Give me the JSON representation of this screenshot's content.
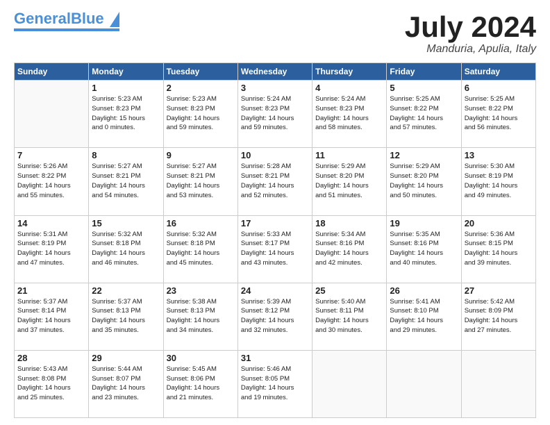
{
  "header": {
    "logo_general": "General",
    "logo_blue": "Blue",
    "month_title": "July 2024",
    "location": "Manduria, Apulia, Italy"
  },
  "days_of_week": [
    "Sunday",
    "Monday",
    "Tuesday",
    "Wednesday",
    "Thursday",
    "Friday",
    "Saturday"
  ],
  "weeks": [
    [
      {
        "day": "",
        "info": ""
      },
      {
        "day": "1",
        "info": "Sunrise: 5:23 AM\nSunset: 8:23 PM\nDaylight: 15 hours\nand 0 minutes."
      },
      {
        "day": "2",
        "info": "Sunrise: 5:23 AM\nSunset: 8:23 PM\nDaylight: 14 hours\nand 59 minutes."
      },
      {
        "day": "3",
        "info": "Sunrise: 5:24 AM\nSunset: 8:23 PM\nDaylight: 14 hours\nand 59 minutes."
      },
      {
        "day": "4",
        "info": "Sunrise: 5:24 AM\nSunset: 8:23 PM\nDaylight: 14 hours\nand 58 minutes."
      },
      {
        "day": "5",
        "info": "Sunrise: 5:25 AM\nSunset: 8:22 PM\nDaylight: 14 hours\nand 57 minutes."
      },
      {
        "day": "6",
        "info": "Sunrise: 5:25 AM\nSunset: 8:22 PM\nDaylight: 14 hours\nand 56 minutes."
      }
    ],
    [
      {
        "day": "7",
        "info": "Sunrise: 5:26 AM\nSunset: 8:22 PM\nDaylight: 14 hours\nand 55 minutes."
      },
      {
        "day": "8",
        "info": "Sunrise: 5:27 AM\nSunset: 8:21 PM\nDaylight: 14 hours\nand 54 minutes."
      },
      {
        "day": "9",
        "info": "Sunrise: 5:27 AM\nSunset: 8:21 PM\nDaylight: 14 hours\nand 53 minutes."
      },
      {
        "day": "10",
        "info": "Sunrise: 5:28 AM\nSunset: 8:21 PM\nDaylight: 14 hours\nand 52 minutes."
      },
      {
        "day": "11",
        "info": "Sunrise: 5:29 AM\nSunset: 8:20 PM\nDaylight: 14 hours\nand 51 minutes."
      },
      {
        "day": "12",
        "info": "Sunrise: 5:29 AM\nSunset: 8:20 PM\nDaylight: 14 hours\nand 50 minutes."
      },
      {
        "day": "13",
        "info": "Sunrise: 5:30 AM\nSunset: 8:19 PM\nDaylight: 14 hours\nand 49 minutes."
      }
    ],
    [
      {
        "day": "14",
        "info": "Sunrise: 5:31 AM\nSunset: 8:19 PM\nDaylight: 14 hours\nand 47 minutes."
      },
      {
        "day": "15",
        "info": "Sunrise: 5:32 AM\nSunset: 8:18 PM\nDaylight: 14 hours\nand 46 minutes."
      },
      {
        "day": "16",
        "info": "Sunrise: 5:32 AM\nSunset: 8:18 PM\nDaylight: 14 hours\nand 45 minutes."
      },
      {
        "day": "17",
        "info": "Sunrise: 5:33 AM\nSunset: 8:17 PM\nDaylight: 14 hours\nand 43 minutes."
      },
      {
        "day": "18",
        "info": "Sunrise: 5:34 AM\nSunset: 8:16 PM\nDaylight: 14 hours\nand 42 minutes."
      },
      {
        "day": "19",
        "info": "Sunrise: 5:35 AM\nSunset: 8:16 PM\nDaylight: 14 hours\nand 40 minutes."
      },
      {
        "day": "20",
        "info": "Sunrise: 5:36 AM\nSunset: 8:15 PM\nDaylight: 14 hours\nand 39 minutes."
      }
    ],
    [
      {
        "day": "21",
        "info": "Sunrise: 5:37 AM\nSunset: 8:14 PM\nDaylight: 14 hours\nand 37 minutes."
      },
      {
        "day": "22",
        "info": "Sunrise: 5:37 AM\nSunset: 8:13 PM\nDaylight: 14 hours\nand 35 minutes."
      },
      {
        "day": "23",
        "info": "Sunrise: 5:38 AM\nSunset: 8:13 PM\nDaylight: 14 hours\nand 34 minutes."
      },
      {
        "day": "24",
        "info": "Sunrise: 5:39 AM\nSunset: 8:12 PM\nDaylight: 14 hours\nand 32 minutes."
      },
      {
        "day": "25",
        "info": "Sunrise: 5:40 AM\nSunset: 8:11 PM\nDaylight: 14 hours\nand 30 minutes."
      },
      {
        "day": "26",
        "info": "Sunrise: 5:41 AM\nSunset: 8:10 PM\nDaylight: 14 hours\nand 29 minutes."
      },
      {
        "day": "27",
        "info": "Sunrise: 5:42 AM\nSunset: 8:09 PM\nDaylight: 14 hours\nand 27 minutes."
      }
    ],
    [
      {
        "day": "28",
        "info": "Sunrise: 5:43 AM\nSunset: 8:08 PM\nDaylight: 14 hours\nand 25 minutes."
      },
      {
        "day": "29",
        "info": "Sunrise: 5:44 AM\nSunset: 8:07 PM\nDaylight: 14 hours\nand 23 minutes."
      },
      {
        "day": "30",
        "info": "Sunrise: 5:45 AM\nSunset: 8:06 PM\nDaylight: 14 hours\nand 21 minutes."
      },
      {
        "day": "31",
        "info": "Sunrise: 5:46 AM\nSunset: 8:05 PM\nDaylight: 14 hours\nand 19 minutes."
      },
      {
        "day": "",
        "info": ""
      },
      {
        "day": "",
        "info": ""
      },
      {
        "day": "",
        "info": ""
      }
    ]
  ]
}
